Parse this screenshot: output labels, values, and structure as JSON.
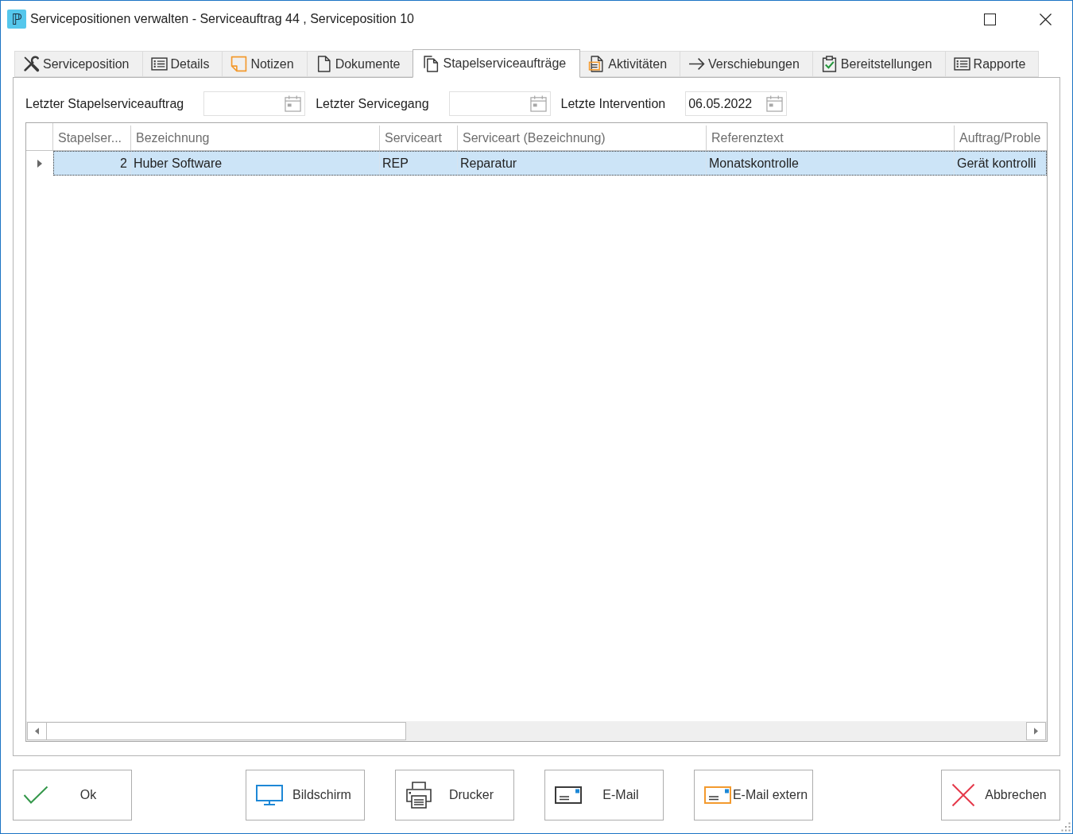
{
  "window": {
    "title": "Servicepositionen verwalten - Serviceauftrag 44 , Serviceposition 10",
    "app_icon": "ℙ"
  },
  "tabs": [
    {
      "label": "Serviceposition",
      "selected": false
    },
    {
      "label": "Details",
      "selected": false
    },
    {
      "label": "Notizen",
      "selected": false
    },
    {
      "label": "Dokumente",
      "selected": false
    },
    {
      "label": "Stapelserviceaufträge",
      "selected": true
    },
    {
      "label": "Aktivitäten",
      "selected": false
    },
    {
      "label": "Verschiebungen",
      "selected": false
    },
    {
      "label": "Bereitstellungen",
      "selected": false
    },
    {
      "label": "Rapporte",
      "selected": false
    }
  ],
  "filters": [
    {
      "label": "Letzter Stapelserviceauftrag"
    },
    {
      "label": "Letzter Servicegang"
    },
    {
      "label": "Letzte Intervention",
      "value": "06.05.2022"
    }
  ],
  "table": {
    "columns": [
      {
        "label": "Stapelser...",
        "kind": "number"
      },
      {
        "label": "Bezeichnung",
        "kind": "text"
      },
      {
        "label": "Serviceart",
        "kind": "text"
      },
      {
        "label": "Serviceart (Bezeichnung)",
        "kind": "text"
      },
      {
        "label": "Referenztext",
        "kind": "text"
      },
      {
        "label": "Auftrag/Proble",
        "kind": "text"
      }
    ],
    "rows": [
      {
        "selected": true,
        "cells": [
          "2",
          "Huber Software",
          "REP",
          "Reparatur",
          "Monatskontrolle",
          "Gerät kontrolli"
        ]
      }
    ]
  },
  "footer": {
    "left_buttons": [
      {
        "label": "Ok"
      }
    ],
    "middle_buttons": [
      {
        "label": "Bildschirm"
      },
      {
        "label": "Drucker"
      },
      {
        "label": "E-Mail"
      },
      {
        "label": "E-Mail extern"
      }
    ],
    "right_buttons": [
      {
        "label": "Abbrechen"
      }
    ]
  }
}
